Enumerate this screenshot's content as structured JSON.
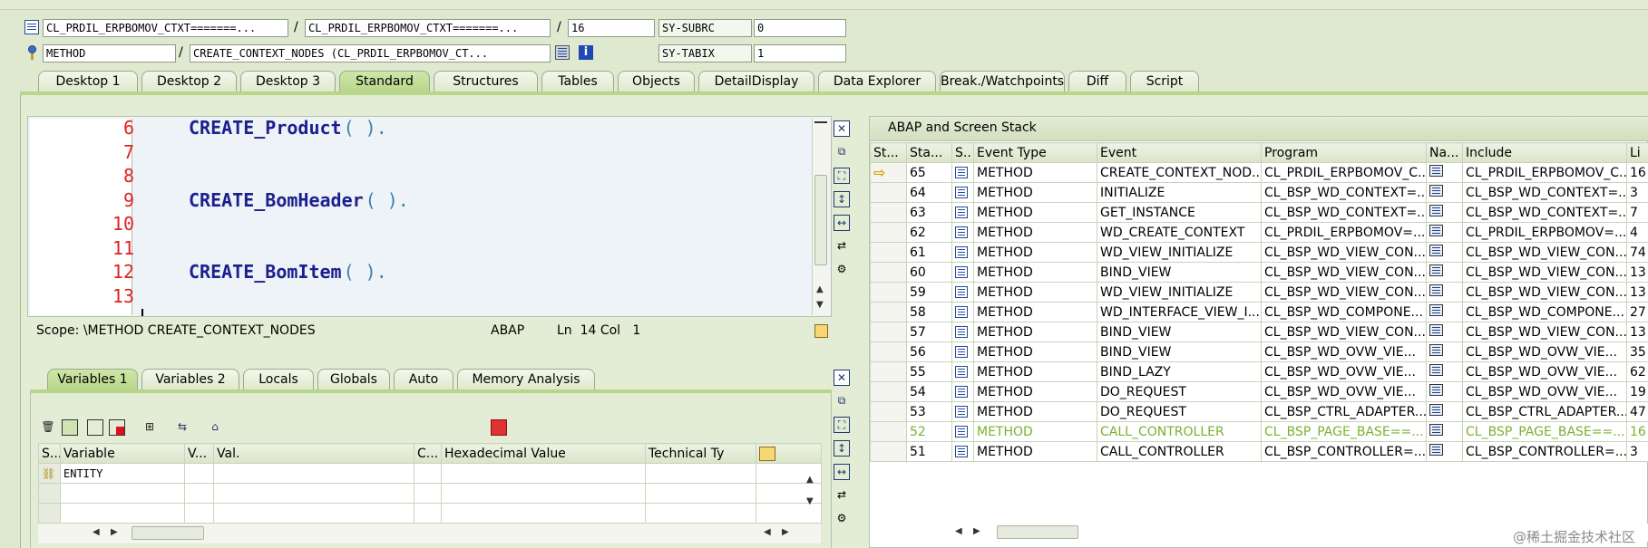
{
  "header": {
    "class_field": "CL_PRDIL_ERPBOMOV_CTXT=======...",
    "include_field": "CL_PRDIL_ERPBOMOV_CTXT=======...",
    "line_field": "16",
    "subrc_label": "SY-SUBRC",
    "subrc_value": "0",
    "type_field": "METHOD",
    "method_field": "CREATE_CONTEXT_NODES (CL_PRDIL_ERPBOMOV_CT...",
    "tabix_label": "SY-TABIX",
    "tabix_value": "1",
    "separator": "/"
  },
  "main_tabs": [
    {
      "label": "Desktop 1"
    },
    {
      "label": "Desktop 2"
    },
    {
      "label": "Desktop 3"
    },
    {
      "label": "Standard"
    },
    {
      "label": "Structures"
    },
    {
      "label": "Tables"
    },
    {
      "label": "Objects"
    },
    {
      "label": "DetailDisplay"
    },
    {
      "label": "Data Explorer"
    },
    {
      "label": "Break./Watchpoints"
    },
    {
      "label": "Diff"
    },
    {
      "label": "Script"
    }
  ],
  "active_main_tab": "Standard",
  "editor": {
    "lines": [
      {
        "num": "6",
        "code": "CREATE_Product",
        "tail": "( )."
      },
      {
        "num": "7",
        "code": "",
        "tail": ""
      },
      {
        "num": "8",
        "code": "",
        "tail": ""
      },
      {
        "num": "9",
        "code": "CREATE_BomHeader",
        "tail": "( )."
      },
      {
        "num": "10",
        "code": "",
        "tail": ""
      },
      {
        "num": "11",
        "code": "",
        "tail": ""
      },
      {
        "num": "12",
        "code": "CREATE_BomItem",
        "tail": "( )."
      },
      {
        "num": "13",
        "code": "",
        "tail": ""
      }
    ],
    "status_scope": "Scope: \\METHOD CREATE_CONTEXT_NODES",
    "status_lang": "ABAP",
    "status_pos": "Ln  14 Col   1"
  },
  "var_tabs": [
    {
      "label": "Variables 1"
    },
    {
      "label": "Variables 2"
    },
    {
      "label": "Locals"
    },
    {
      "label": "Globals"
    },
    {
      "label": "Auto"
    },
    {
      "label": "Memory Analysis"
    }
  ],
  "active_var_tab": "Variables 1",
  "variables": {
    "columns": [
      "S...",
      "Variable",
      "V...",
      "Val.",
      "C...",
      "Hexadecimal Value",
      "Technical Ty"
    ],
    "rows": [
      {
        "variable": "ENTITY"
      }
    ]
  },
  "stack": {
    "title": "ABAP and Screen Stack",
    "columns": [
      "St...",
      "Sta...",
      "S..",
      "Event Type",
      "Event",
      "Program",
      "Na...",
      "Include",
      "Li"
    ],
    "rows": [
      {
        "sta": "65",
        "type": "METHOD",
        "event": "CREATE_CONTEXT_NOD...",
        "program": "CL_PRDIL_ERPBOMOV_C...",
        "include": "CL_PRDIL_ERPBOMOV_C...",
        "li": "16",
        "current": true
      },
      {
        "sta": "64",
        "type": "METHOD",
        "event": "INITIALIZE",
        "program": "CL_BSP_WD_CONTEXT=...",
        "include": "CL_BSP_WD_CONTEXT=...",
        "li": "3"
      },
      {
        "sta": "63",
        "type": "METHOD",
        "event": "GET_INSTANCE",
        "program": "CL_BSP_WD_CONTEXT=...",
        "include": "CL_BSP_WD_CONTEXT=...",
        "li": "7"
      },
      {
        "sta": "62",
        "type": "METHOD",
        "event": "WD_CREATE_CONTEXT",
        "program": "CL_PRDIL_ERPBOMOV=...",
        "include": "CL_PRDIL_ERPBOMOV=...",
        "li": "4"
      },
      {
        "sta": "61",
        "type": "METHOD",
        "event": "WD_VIEW_INITIALIZE",
        "program": "CL_BSP_WD_VIEW_CON...",
        "include": "CL_BSP_WD_VIEW_CON...",
        "li": "74"
      },
      {
        "sta": "60",
        "type": "METHOD",
        "event": "BIND_VIEW",
        "program": "CL_BSP_WD_VIEW_CON...",
        "include": "CL_BSP_WD_VIEW_CON...",
        "li": "13"
      },
      {
        "sta": "59",
        "type": "METHOD",
        "event": "WD_VIEW_INITIALIZE",
        "program": "CL_BSP_WD_VIEW_CON...",
        "include": "CL_BSP_WD_VIEW_CON...",
        "li": "13"
      },
      {
        "sta": "58",
        "type": "METHOD",
        "event": "WD_INTERFACE_VIEW_I...",
        "program": "CL_BSP_WD_COMPONE...",
        "include": "CL_BSP_WD_COMPONE...",
        "li": "27"
      },
      {
        "sta": "57",
        "type": "METHOD",
        "event": "BIND_VIEW",
        "program": "CL_BSP_WD_VIEW_CON...",
        "include": "CL_BSP_WD_VIEW_CON...",
        "li": "13"
      },
      {
        "sta": "56",
        "type": "METHOD",
        "event": "BIND_VIEW",
        "program": "CL_BSP_WD_OVW_VIE...",
        "include": "CL_BSP_WD_OVW_VIE...",
        "li": "35"
      },
      {
        "sta": "55",
        "type": "METHOD",
        "event": "BIND_LAZY",
        "program": "CL_BSP_WD_OVW_VIE...",
        "include": "CL_BSP_WD_OVW_VIE...",
        "li": "62"
      },
      {
        "sta": "54",
        "type": "METHOD",
        "event": "DO_REQUEST",
        "program": "CL_BSP_WD_OVW_VIE...",
        "include": "CL_BSP_WD_OVW_VIE...",
        "li": "19"
      },
      {
        "sta": "53",
        "type": "METHOD",
        "event": "DO_REQUEST",
        "program": "CL_BSP_CTRL_ADAPTER...",
        "include": "CL_BSP_CTRL_ADAPTER...",
        "li": "47"
      },
      {
        "sta": "52",
        "type": "METHOD",
        "event": "CALL_CONTROLLER",
        "program": "CL_BSP_PAGE_BASE==...",
        "include": "CL_BSP_PAGE_BASE==...",
        "li": "16",
        "green": true
      },
      {
        "sta": "51",
        "type": "METHOD",
        "event": "CALL_CONTROLLER",
        "program": "CL_BSP_CONTROLLER=...",
        "include": "CL_BSP_CONTROLLER=...",
        "li": "3"
      }
    ]
  },
  "watermark": "@稀土掘金技术社区",
  "colors": {
    "accent": "#b8d68a",
    "line_number": "#dd2222",
    "keyword": "#1b1f8e",
    "green_row": "#7ab030"
  }
}
